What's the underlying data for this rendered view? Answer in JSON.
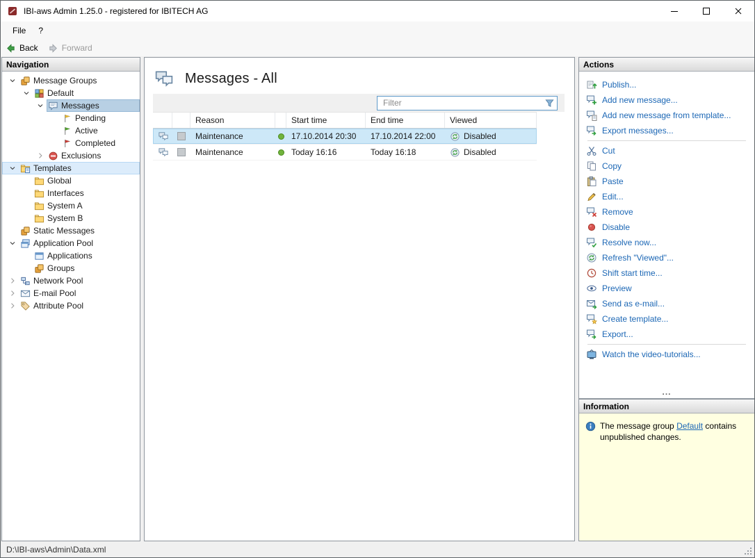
{
  "window": {
    "title": "IBI-aws Admin 1.25.0 - registered for IBITECH AG",
    "controls": {
      "minimize": "minimize",
      "maximize": "maximize",
      "close": "close"
    }
  },
  "menu": {
    "items": [
      {
        "label": "File"
      },
      {
        "label": "?"
      }
    ]
  },
  "toolbar": {
    "back_label": "Back",
    "forward_label": "Forward"
  },
  "navigation": {
    "header": "Navigation",
    "items": [
      {
        "label": "Message Groups",
        "icon": "message-groups-icon",
        "state": "expanded"
      },
      {
        "label": "Default",
        "icon": "message-group-icon",
        "state": "expanded"
      },
      {
        "label": "Messages",
        "icon": "messages-icon",
        "state": "expanded",
        "selected": true
      },
      {
        "label": "Pending",
        "icon": "pending-flag-icon"
      },
      {
        "label": "Active",
        "icon": "active-flag-icon"
      },
      {
        "label": "Completed",
        "icon": "completed-flag-icon"
      },
      {
        "label": "Exclusions",
        "icon": "exclusions-icon",
        "state": "collapsed"
      },
      {
        "label": "Templates",
        "icon": "templates-folder-icon",
        "state": "expanded",
        "highlighted": true
      },
      {
        "label": "Global",
        "icon": "folder-icon"
      },
      {
        "label": "Interfaces",
        "icon": "folder-icon"
      },
      {
        "label": "System A",
        "icon": "folder-icon"
      },
      {
        "label": "System B",
        "icon": "folder-icon"
      },
      {
        "label": "Static Messages",
        "icon": "static-messages-icon"
      },
      {
        "label": "Application Pool",
        "icon": "application-pool-icon",
        "state": "expanded"
      },
      {
        "label": "Applications",
        "icon": "applications-icon"
      },
      {
        "label": "Groups",
        "icon": "groups-icon"
      },
      {
        "label": "Network Pool",
        "icon": "network-pool-icon",
        "state": "collapsed"
      },
      {
        "label": "E-mail Pool",
        "icon": "email-pool-icon",
        "state": "collapsed"
      },
      {
        "label": "Attribute Pool",
        "icon": "attribute-pool-icon",
        "state": "collapsed"
      }
    ]
  },
  "main": {
    "title": "Messages - All",
    "filter_placeholder": "Filter",
    "table": {
      "columns": [
        "",
        "",
        "Reason",
        "",
        "Start time",
        "End time",
        "Viewed"
      ],
      "rows": [
        {
          "reason": "Maintenance",
          "start": "17.10.2014 20:30",
          "end": "17.10.2014 22:00",
          "viewed": "Disabled",
          "selected": true
        },
        {
          "reason": "Maintenance",
          "start": "Today 16:16",
          "end": "Today 16:18",
          "viewed": "Disabled",
          "selected": false
        }
      ]
    }
  },
  "actions": {
    "header": "Actions",
    "groups": [
      {
        "items": [
          {
            "label": "Publish...",
            "icon": "publish-icon"
          },
          {
            "label": "Add new message...",
            "icon": "add-message-icon"
          },
          {
            "label": "Add new message from template...",
            "icon": "add-from-template-icon"
          },
          {
            "label": "Export messages...",
            "icon": "export-messages-icon"
          }
        ]
      },
      {
        "items": [
          {
            "label": "Cut",
            "icon": "cut-icon"
          },
          {
            "label": "Copy",
            "icon": "copy-icon"
          },
          {
            "label": "Paste",
            "icon": "paste-icon"
          },
          {
            "label": "Edit...",
            "icon": "edit-icon"
          },
          {
            "label": "Remove",
            "icon": "remove-icon"
          },
          {
            "label": "Disable",
            "icon": "disable-icon"
          },
          {
            "label": "Resolve now...",
            "icon": "resolve-icon"
          },
          {
            "label": "Refresh \"Viewed\"...",
            "icon": "refresh-viewed-icon"
          },
          {
            "label": "Shift start time...",
            "icon": "shift-start-time-icon"
          },
          {
            "label": "Preview",
            "icon": "preview-icon"
          },
          {
            "label": "Send as e-mail...",
            "icon": "send-email-icon"
          },
          {
            "label": "Create template...",
            "icon": "create-template-icon"
          },
          {
            "label": "Export...",
            "icon": "export-icon"
          }
        ]
      },
      {
        "items": [
          {
            "label": "Watch the video-tutorials...",
            "icon": "video-tutorials-icon"
          }
        ]
      }
    ],
    "overflow": "..."
  },
  "information": {
    "header": "Information",
    "text_before": "The message group ",
    "link_text": "Default",
    "text_after": " contains unpublished changes."
  },
  "statusbar": {
    "path": "D:\\IBI-aws\\Admin\\Data.xml"
  },
  "colors": {
    "link": "#1c67b5",
    "selection": "#cde8f8",
    "info_bg": "#ffffe1",
    "accent_green": "#3f9e46"
  }
}
